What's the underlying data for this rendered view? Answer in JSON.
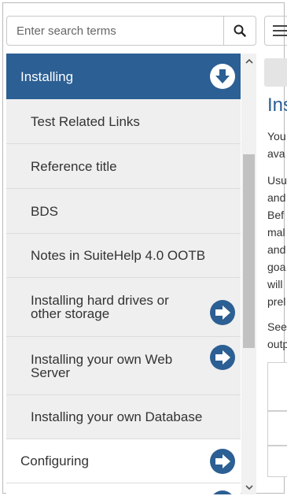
{
  "search": {
    "placeholder": "Enter search terms"
  },
  "nav": {
    "items": [
      {
        "label": "Installing",
        "kind": "active",
        "icon": "circle-arrow-down-icon"
      },
      {
        "label": "Test Related Links",
        "kind": "sub"
      },
      {
        "label": "Reference title",
        "kind": "sub"
      },
      {
        "label": "BDS",
        "kind": "sub"
      },
      {
        "label": "Notes in SuiteHelp 4.0 OOTB",
        "kind": "sub"
      },
      {
        "label": "Installing hard drives or other storage",
        "kind": "sub",
        "icon": "circle-arrow-right-icon"
      },
      {
        "label": "Installing your own Web Server",
        "kind": "sub",
        "icon": "circle-arrow-right-icon"
      },
      {
        "label": "Installing your own Database",
        "kind": "sub"
      },
      {
        "label": "Configuring",
        "kind": "top",
        "icon": "circle-arrow-right-icon"
      }
    ]
  },
  "content": {
    "title": "Ins",
    "para1": [
      "You",
      "ava"
    ],
    "para2": [
      "Usu",
      "and",
      "Bef",
      "mal",
      "and",
      "goa",
      "will",
      "prel"
    ],
    "para3": [
      "See",
      "outp"
    ]
  },
  "colors": {
    "accent": "#2c5f93",
    "sub_bg": "#efefef"
  }
}
